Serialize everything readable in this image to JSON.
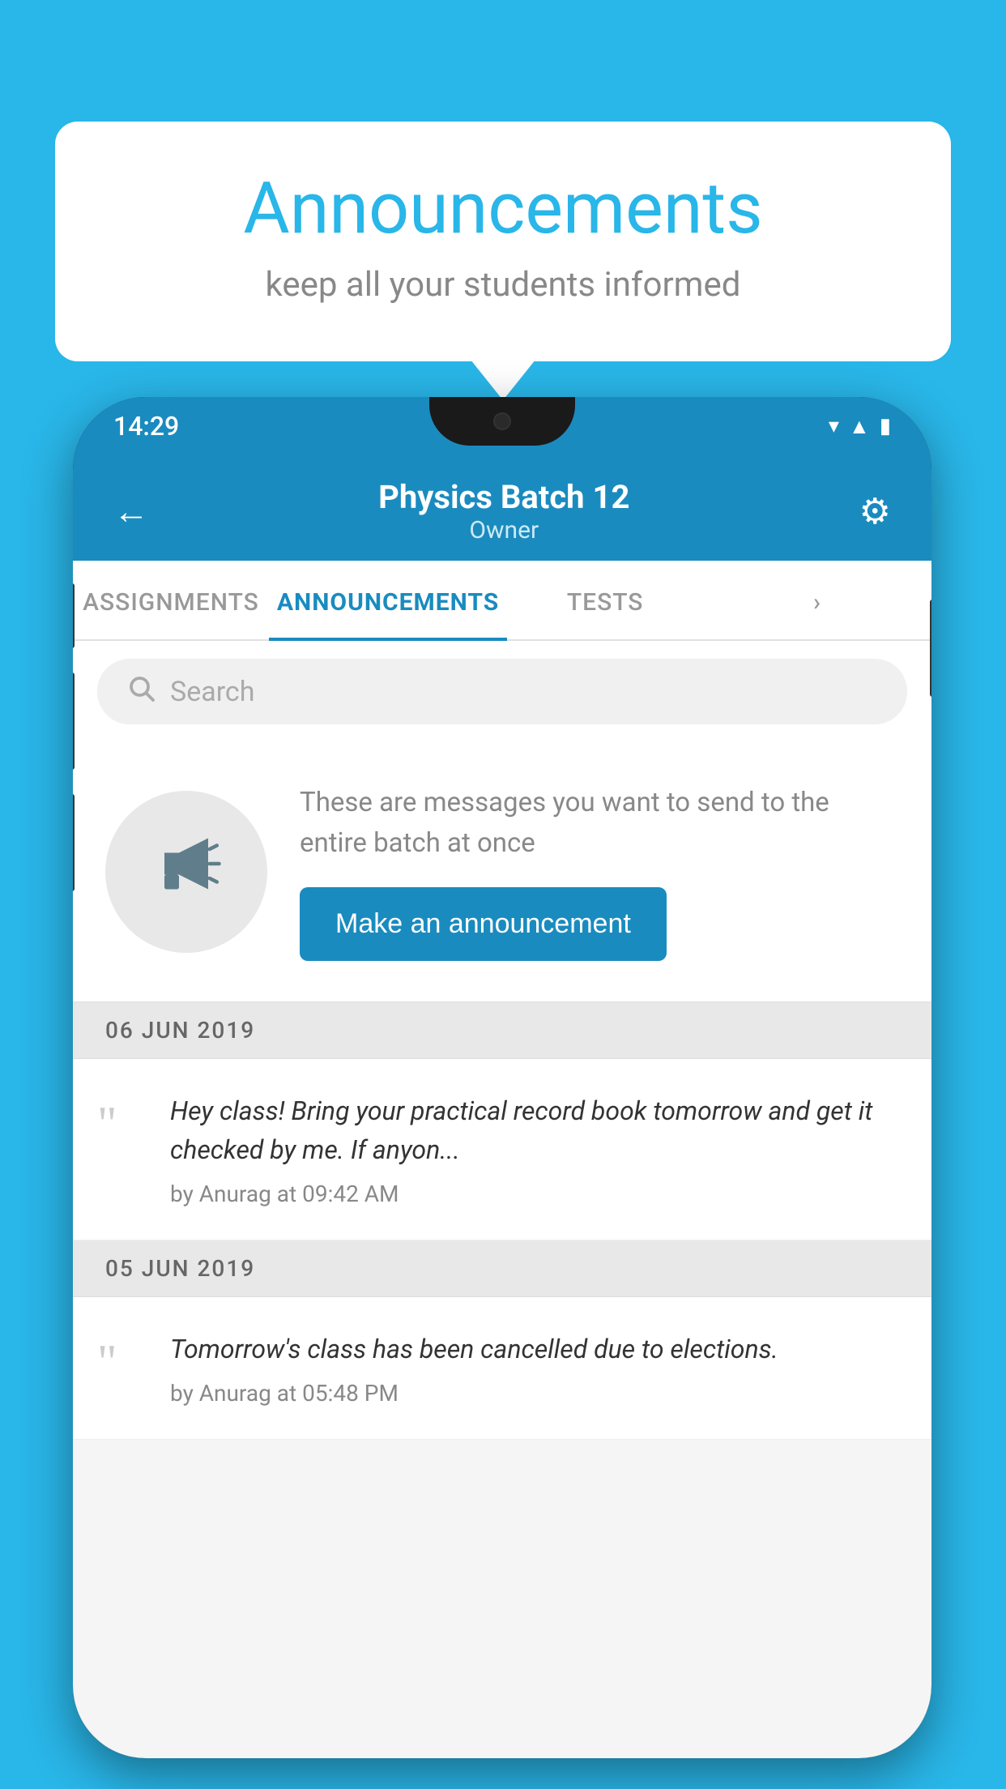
{
  "background_color": "#29b6e8",
  "speech_bubble": {
    "title": "Announcements",
    "subtitle": "keep all your students informed"
  },
  "phone": {
    "status_bar": {
      "time": "14:29",
      "icons": [
        "wifi",
        "signal",
        "battery"
      ]
    },
    "header": {
      "batch_name": "Physics Batch 12",
      "role": "Owner",
      "back_label": "←",
      "settings_label": "⚙"
    },
    "tabs": [
      {
        "label": "ASSIGNMENTS",
        "active": false
      },
      {
        "label": "ANNOUNCEMENTS",
        "active": true
      },
      {
        "label": "TESTS",
        "active": false
      },
      {
        "label": "›",
        "active": false
      }
    ],
    "search": {
      "placeholder": "Search"
    },
    "announcement_prompt": {
      "description": "These are messages you want to send to the entire batch at once",
      "button_label": "Make an announcement"
    },
    "announcements": [
      {
        "date": "06  JUN  2019",
        "text": "Hey class! Bring your practical record book tomorrow and get it checked by me. If anyon...",
        "meta": "by Anurag at 09:42 AM"
      },
      {
        "date": "05  JUN  2019",
        "text": "Tomorrow's class has been cancelled due to elections.",
        "meta": "by Anurag at 05:48 PM"
      }
    ]
  }
}
